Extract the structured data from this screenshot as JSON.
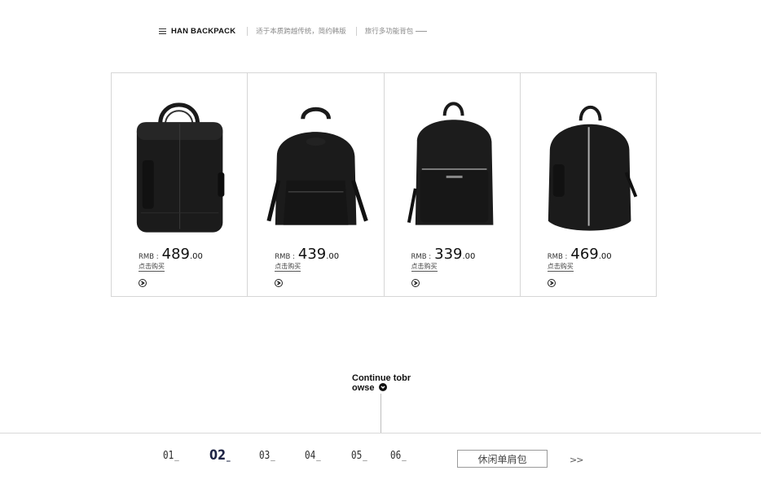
{
  "header": {
    "brand": "HAN BACKPACK",
    "tagline1": "适于本质跨越传统，简约韩版",
    "tagline2": "旅行多功能背包"
  },
  "products": [
    {
      "currency": "RMB :",
      "price_int": "489",
      "price_dec": ".00",
      "buy_label": "点击购买"
    },
    {
      "currency": "RMB :",
      "price_int": "439",
      "price_dec": ".00",
      "buy_label": "点击购买"
    },
    {
      "currency": "RMB :",
      "price_int": "339",
      "price_dec": ".00",
      "buy_label": "点击购买"
    },
    {
      "currency": "RMB :",
      "price_int": "469",
      "price_dec": ".00",
      "buy_label": "点击购买"
    }
  ],
  "continue_label_line1": "Continue tobr",
  "continue_label_line2": "owse",
  "pagination": {
    "pages": [
      "01",
      "02",
      "03",
      "04",
      "05",
      "06"
    ],
    "active": "02",
    "underscore": "_"
  },
  "category_label": "休闲单肩包",
  "next_label": ">>",
  "colors": {
    "active_page": "#1e2445",
    "border": "#d6d6d6",
    "bag": "#1a1a1a"
  }
}
